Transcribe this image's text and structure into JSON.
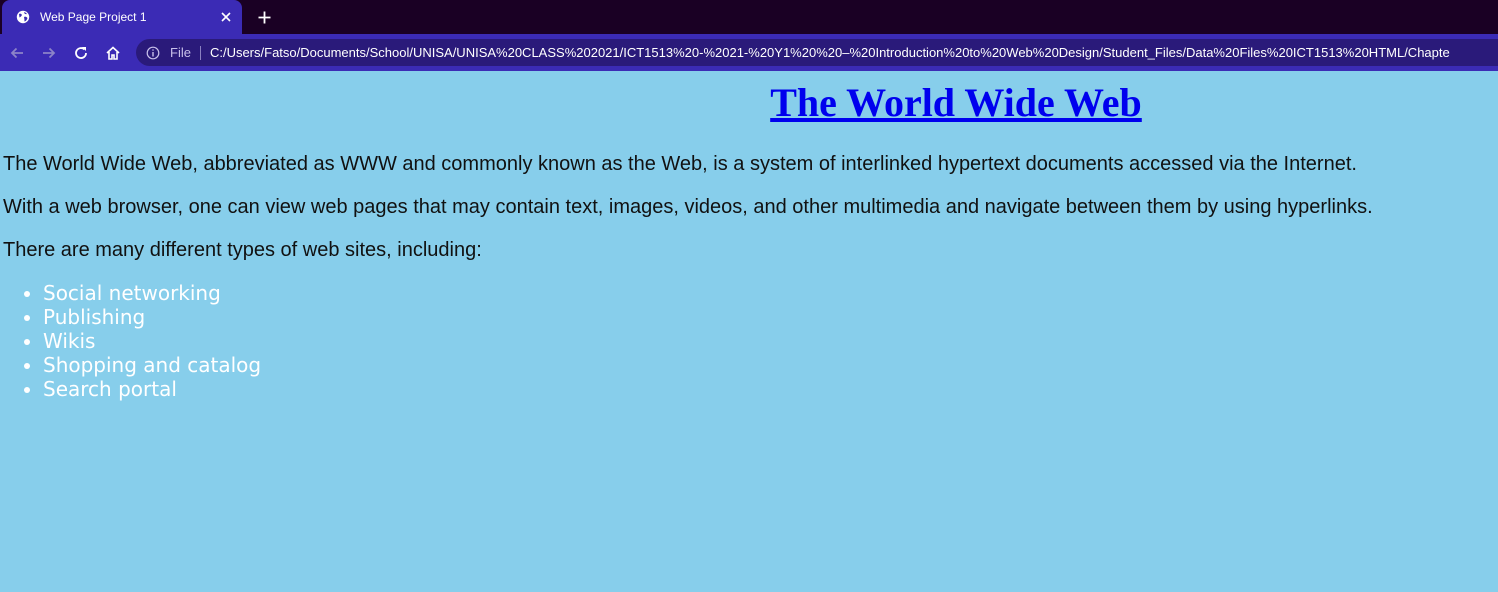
{
  "browser": {
    "tab": {
      "title": "Web Page Project 1"
    },
    "address_bar": {
      "scheme_label": "File",
      "url": "C:/Users/Fatso/Documents/School/UNISA/UNISA%20CLASS%202021/ICT1513%20-%2021-%20Y1%20%20–%20Introduction%20to%20Web%20Design/Student_Files/Data%20Files%20ICT1513%20HTML/Chapte"
    }
  },
  "page": {
    "heading": "The World Wide Web",
    "paragraphs": [
      "The World Wide Web, abbreviated as WWW and commonly known as the Web, is a system of interlinked hypertext documents accessed via the Internet.",
      "With a web browser, one can view web pages that may contain text, images, videos, and other multimedia and navigate between them by using hyperlinks.",
      "There are many different types of web sites, including:"
    ],
    "site_types": [
      "Social networking",
      "Publishing",
      "Wikis",
      "Shopping and catalog",
      "Search portal"
    ]
  },
  "colors": {
    "page_background": "#87ceeb",
    "heading_link": "#0000ee",
    "list_text": "#ffffff",
    "browser_frame": "#3b2bb5"
  }
}
